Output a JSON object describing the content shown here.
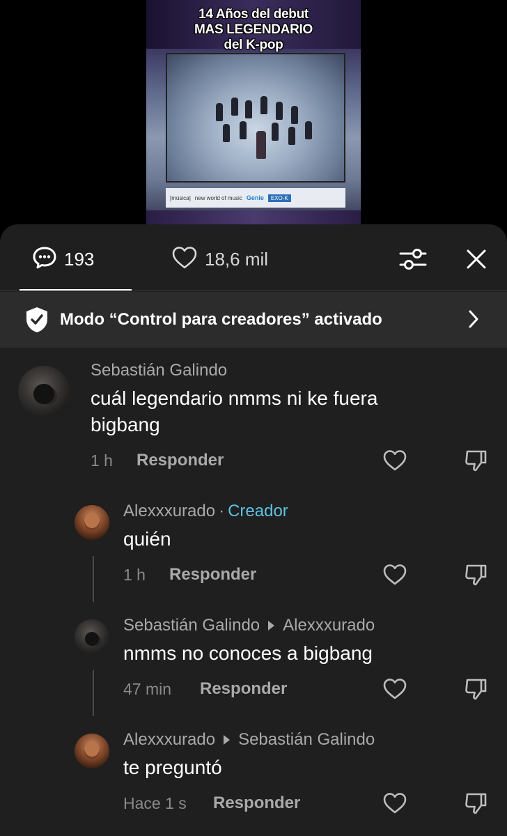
{
  "video": {
    "caption_line1": "14 Años del debut",
    "caption_line2": "MAS LEGENDARIO",
    "caption_line3": "del K-pop",
    "tvbar_text": "new world of music",
    "tvbar_brand": "Genie",
    "tvbar_tag": "EXO-K",
    "tvbar_channel": "[música]"
  },
  "tabs": {
    "comments_count": "193",
    "likes_count": "18,6 mil"
  },
  "banner": {
    "text": "Modo “Control para creadores” activado"
  },
  "comments": [
    {
      "author": "Sebastián Galindo",
      "text_line1": "cuál legendario nmms ni ke fuera",
      "text_line2": "bigbang",
      "time": "1 h",
      "reply_label": "Responder"
    },
    {
      "author": "Alexxxurado",
      "separator": "·",
      "badge": "Creador",
      "text": "quién",
      "time": "1 h",
      "reply_label": "Responder"
    },
    {
      "author": "Sebastián Galindo",
      "reply_to": "Alexxxurado",
      "text": "nmms no conoces a bigbang",
      "time": "47 min",
      "reply_label": "Responder"
    },
    {
      "author": "Alexxxurado",
      "reply_to": "Sebastián Galindo",
      "text": "te preguntó",
      "time": "Hace 1 s",
      "reply_label": "Responder"
    }
  ],
  "icons": {
    "comments_tab": "speech-bubble-icon",
    "likes_tab": "heart-icon",
    "filter": "sliders-icon",
    "close": "close-icon",
    "banner": "shield-check-icon",
    "banner_chevron": "chevron-right-icon",
    "like": "heart-icon",
    "dislike": "thumbs-down-icon"
  },
  "colors": {
    "sheet_bg": "#1f1f1f",
    "banner_bg": "#2c2c2c",
    "creator_badge": "#5bc1e0",
    "secondary_text": "#a9a9a9"
  }
}
